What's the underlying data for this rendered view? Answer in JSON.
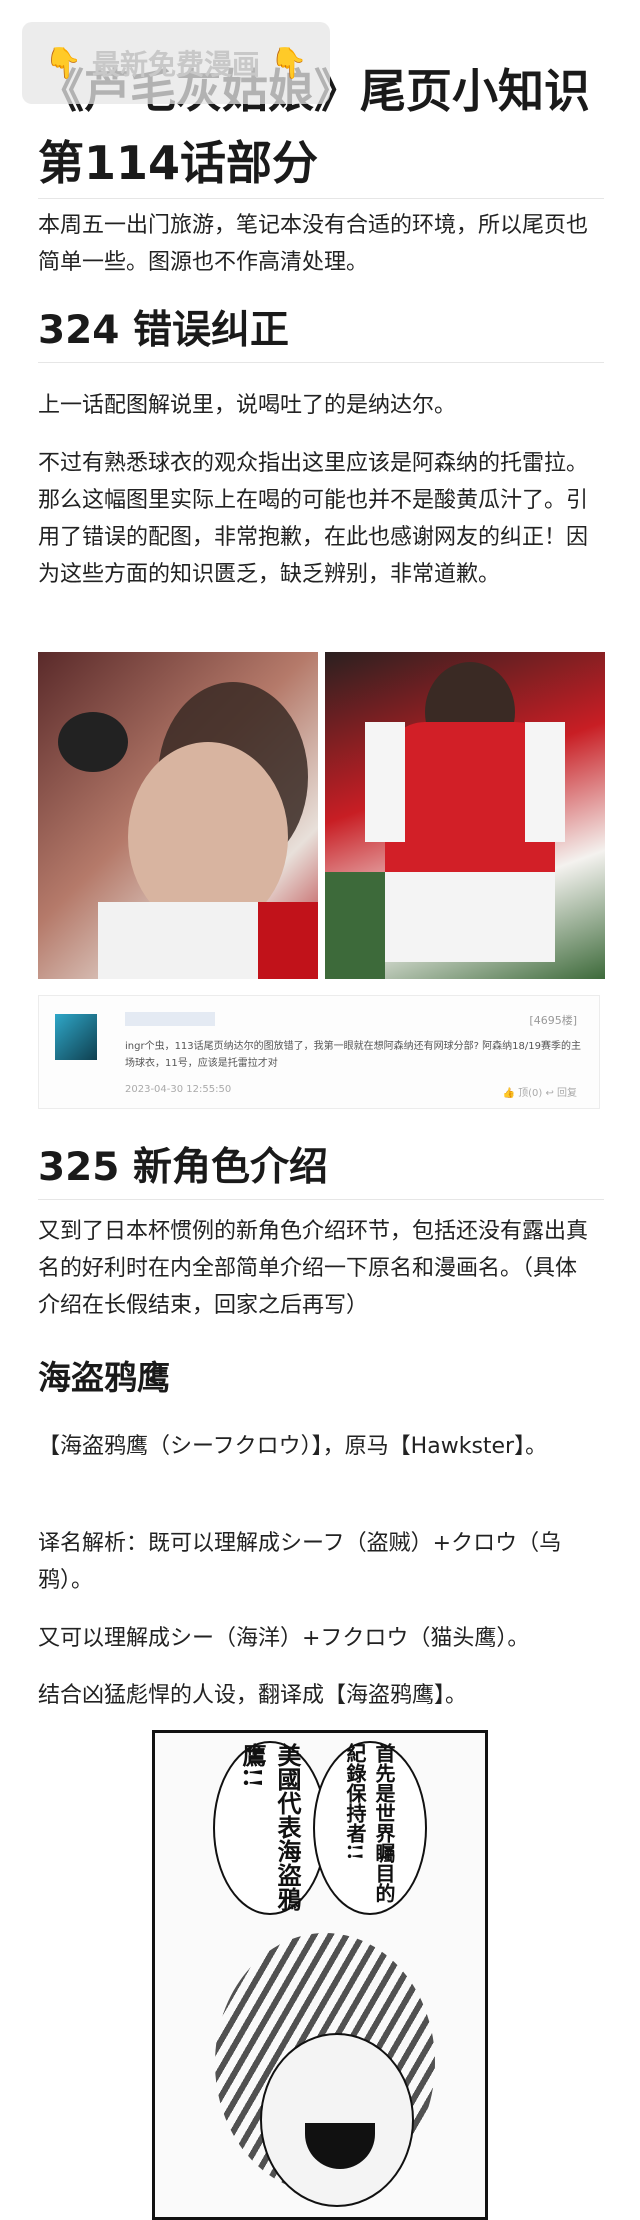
{
  "watermark": {
    "text": "最新免费漫画",
    "hand_icon": "pointing-down-hand-icon"
  },
  "article": {
    "title": "《芦毛灰姑娘》尾页小知识 第114话部分",
    "intro": "本周五一出门旅游，笔记本没有合适的环境，所以尾页也简单一些。图源也不作高清处理。",
    "sections": [
      {
        "heading": "324 错误纠正",
        "paragraphs": [
          "上一话配图解说里，说喝吐了的是纳达尔。",
          "不过有熟悉球衣的观众指出这里应该是阿森纳的托雷拉。那么这幅图里实际上在喝的可能也并不是酸黄瓜汁了。引用了错误的配图，非常抱歉，在此也感谢网友的纠正！因为这些方面的知识匮乏，缺乏辨别，非常道歉。"
        ]
      },
      {
        "heading": "325 新角色介绍",
        "paragraphs": [
          "又到了日本杯惯例的新角色介绍环节，包括还没有露出真名的好利时在内全部简单介绍一下原名和漫画名。（具体介绍在长假结束，回家之后再写）"
        ]
      }
    ],
    "subsection": {
      "heading": "海盗鸦鹰",
      "paragraphs": [
        "【海盗鸦鹰（シーフクロウ）】，原马【Hawkster】。",
        "译名解析：既可以理解成シーフ（盗贼）+クロウ（乌鸦）。",
        "又可以理解成シー（海洋）+フクロウ（猫头鹰）。",
        "结合凶猛彪悍的人设，翻译成【海盗鸦鹰】。"
      ]
    }
  },
  "comment": {
    "like_count": "[4695楼]",
    "text": "ingr个虫，113话尾页纳达尔的图放错了，我第一眼就在想阿森纳还有网球分部? 阿森纳18/19赛季的主场球衣，11号，应该是托雷拉才对",
    "time": "2023-04-30 12:55:50",
    "actions": "👍 顶(0)  ↩ 回复"
  },
  "manga": {
    "bubble_left": "美國代表海盜鴉鷹!!",
    "bubble_right": "首先是世界矚目的紀錄保持者!!"
  }
}
